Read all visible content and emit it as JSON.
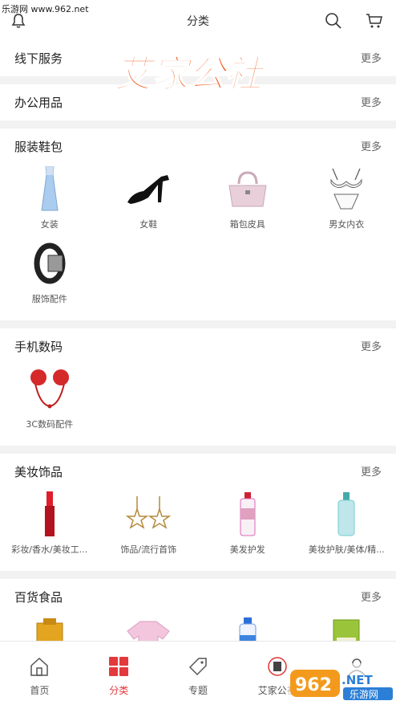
{
  "watermark_top": "乐游网 www.962.net",
  "header": {
    "title": "分类",
    "icons": {
      "left": "bell-icon",
      "search": "search-icon",
      "cart": "cart-icon"
    }
  },
  "brand_overlay": "艾家公社",
  "more_label": "更多",
  "sections": [
    {
      "title": "线下服务",
      "more": "更多",
      "items": []
    },
    {
      "title": "办公用品",
      "more": "更多",
      "items": []
    },
    {
      "title": "服装鞋包",
      "more": "更多",
      "items": [
        {
          "label": "女装",
          "icon": "dress-icon"
        },
        {
          "label": "女鞋",
          "icon": "high-heel-icon"
        },
        {
          "label": "箱包皮具",
          "icon": "handbag-icon"
        },
        {
          "label": "男女内衣",
          "icon": "lingerie-icon"
        },
        {
          "label": "服饰配件",
          "icon": "belt-icon"
        }
      ]
    },
    {
      "title": "手机数码",
      "more": "更多",
      "items": [
        {
          "label": "3C数码配件",
          "icon": "headphones-icon"
        }
      ]
    },
    {
      "title": "美妆饰品",
      "more": "更多",
      "items": [
        {
          "label": "彩妆/香水/美妆工...",
          "icon": "lipstick-icon"
        },
        {
          "label": "饰品/流行首饰",
          "icon": "star-earrings-icon"
        },
        {
          "label": "美发护发",
          "icon": "shampoo-icon"
        },
        {
          "label": "美妆护肤/美体/精...",
          "icon": "toner-bottle-icon"
        }
      ]
    },
    {
      "title": "百货食品",
      "more": "更多",
      "items": [
        {
          "label": "",
          "icon": "liquor-box-icon"
        },
        {
          "label": "",
          "icon": "pink-clothing-icon"
        },
        {
          "label": "",
          "icon": "bodywash-icon"
        },
        {
          "label": "",
          "icon": "rice-bag-icon"
        }
      ]
    }
  ],
  "tabbar": [
    {
      "label": "首页",
      "icon": "home-icon",
      "active": false
    },
    {
      "label": "分类",
      "icon": "category-grid-icon",
      "active": true
    },
    {
      "label": "专题",
      "icon": "tag-icon",
      "active": false
    },
    {
      "label": "艾家公社",
      "icon": "community-logo-icon",
      "active": false
    },
    {
      "label": "",
      "icon": "user-icon",
      "active": false
    }
  ],
  "watermark_bottom": {
    "brand": "962",
    "suffix": ".NET",
    "site": "乐游网"
  },
  "colors": {
    "accent": "#e4393c",
    "brand_orange": "#f05a1a",
    "background": "#f2f2f2"
  }
}
